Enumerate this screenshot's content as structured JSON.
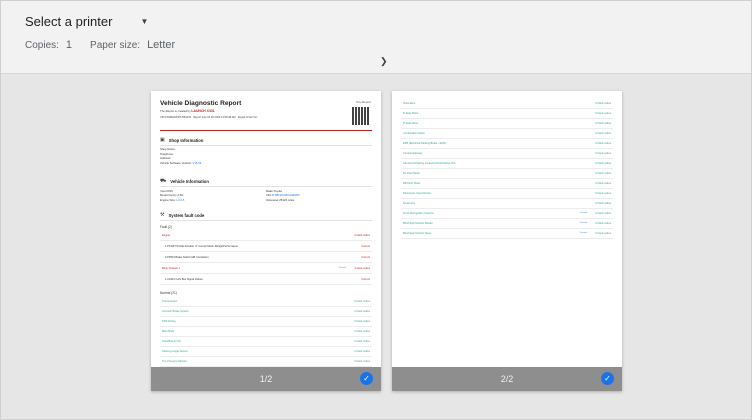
{
  "header": {
    "printer_label": "Select a printer",
    "copies_label": "Copies:",
    "copies_value": "1",
    "paper_label": "Paper size:",
    "paper_value": "Letter"
  },
  "icons": {
    "printer_dropdown": "caret-down-icon",
    "expand": "chevron-down-icon",
    "page_check": "check-circle-icon"
  },
  "colors": {
    "accent": "#1a73e8",
    "brand_red": "#c2241f",
    "ok_teal": "#2aa89a"
  },
  "report": {
    "title": "Vehicle Diagnostic Report",
    "created_by": "The Report is created by",
    "brand": "LAUNCH X431",
    "pre_report": "Pre-Report",
    "vin_line": "VIN:4T1BE46K37U554433",
    "report_time": "Report time:04.30.2024 13:59:48 AM",
    "repair_order": "Repair Order No:",
    "shop_title": "Shop Information",
    "shop_name": "Shop Name:",
    "telephone": "Telephone:",
    "address": "Address:",
    "software_label": "Vehicle Software Version:",
    "software_value": "V15.54",
    "vehicle_title": "Vehicle Information",
    "year": "Year:2015",
    "model": "Model:Camry 2.5G",
    "engine_label": "Engine Size:",
    "engine_value": "L4 2.5",
    "make": "Make:Toyota",
    "vin_label": "VIN:",
    "vin_value": "4T1BF1FK2FU000000",
    "odometer": "Odometer:25123 miles",
    "system_title": "System fault code",
    "fault_header": "Fault (2)",
    "fault_rows": [
      {
        "name": "Engine",
        "status": "2 Fault codes",
        "kind": "fault"
      },
      {
        "name": "1.P2118 Throttle Actuator 'A' Control Motor Range/Performance",
        "status": "Current",
        "kind": "sub"
      },
      {
        "name": "2.P0504 Brake Switch A/B Correlation",
        "status": "Current",
        "kind": "sub"
      },
      {
        "name": "Body Chassis 1",
        "status": "1 Fault codes",
        "kind": "fault",
        "clear": "Cleared"
      },
      {
        "name": "1.C1821 CAN Bus Signal Failure",
        "status": "Current",
        "kind": "sub"
      }
    ],
    "normal_header": "Normal (21)",
    "normal_rows": [
      {
        "name": "Transmission",
        "status": "0 Fault codes"
      },
      {
        "name": "Anti-lock Brake System",
        "status": "0 Fault codes"
      },
      {
        "name": "SRS Airbag",
        "status": "0 Fault codes"
      },
      {
        "name": "Main Body",
        "status": "0 Fault codes"
      },
      {
        "name": "Tire/Wheels Info",
        "status": "0 Fault codes"
      },
      {
        "name": "Steering Angle Sensor",
        "status": "0 Fault codes"
      },
      {
        "name": "Tire Pressure Monitor",
        "status": "0 Fault codes"
      }
    ],
    "page2_rows": [
      {
        "name": "Telematics",
        "status": "0 Fault codes"
      },
      {
        "name": "D-Seat Motor",
        "status": "0 Fault codes"
      },
      {
        "name": "P-Seat Motor",
        "status": "0 Fault codes"
      },
      {
        "name": "Combination Meter",
        "status": "0 Fault codes"
      },
      {
        "name": "EPB (Electrical Parking Brake - EMV)",
        "status": "0 Fault codes"
      },
      {
        "name": "Central Gateway",
        "status": "0 Fault codes"
      },
      {
        "name": "Advanced Parking Guidance/ICS/Intuitive P/A",
        "status": "0 Fault codes"
      },
      {
        "name": "RL Door Motor",
        "status": "0 Fault codes"
      },
      {
        "name": "RR Door Motor",
        "status": "0 Fault codes"
      },
      {
        "name": "Panoramic View Monitor",
        "status": "0 Fault codes"
      },
      {
        "name": "Smart Key",
        "status": "0 Fault codes"
      },
      {
        "name": "Front Recognition Camera",
        "status": "0 Fault codes",
        "clear": "Cleared"
      },
      {
        "name": "Blind Spot Monitor Master",
        "status": "0 Fault codes",
        "clear": "Cleared"
      },
      {
        "name": "Blind Spot Monitor Slave",
        "status": "0 Fault codes",
        "clear": "Cleared"
      }
    ]
  },
  "pages": {
    "page1_label": "1/2",
    "page2_label": "2/2"
  }
}
